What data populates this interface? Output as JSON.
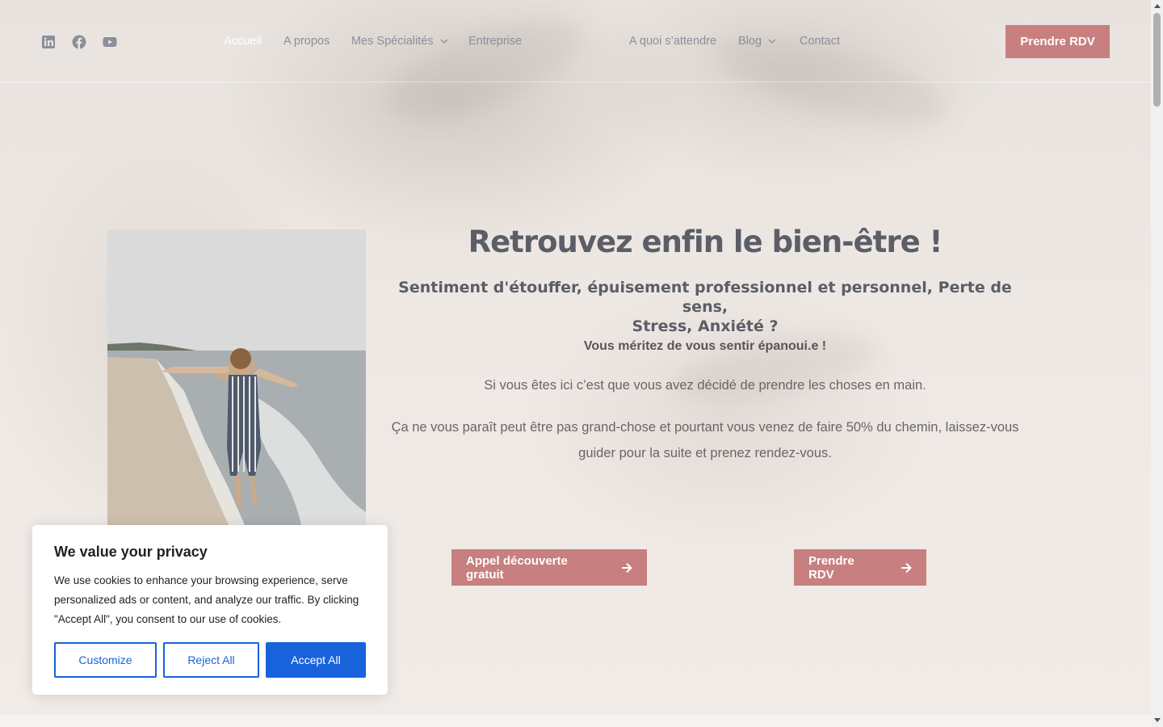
{
  "nav": {
    "items": [
      {
        "label": "Accueil",
        "active": true
      },
      {
        "label": "A propos"
      },
      {
        "label": "Mes Spécialités",
        "dropdown": true
      },
      {
        "label": "Entreprise"
      },
      {
        "label": "A quoi s’attendre"
      },
      {
        "label": "Blog",
        "dropdown": true
      },
      {
        "label": "Contact"
      }
    ],
    "cta_label": "Prendre RDV",
    "social_icons": [
      "linkedin-icon",
      "facebook-icon",
      "youtube-icon"
    ]
  },
  "hero": {
    "title": "Retrouvez enfin le bien-être !",
    "subtitle_line1": "Sentiment d'étouffer, épuisement professionnel et personnel, Perte de sens,",
    "subtitle_line2": "Stress, Anxiété ?",
    "strong_text": "Vous méritez de vous sentir épanoui.e !",
    "paragraph1": "Si vous êtes ici c’est que vous avez décidé de prendre les choses en main.",
    "paragraph2_line1": "Ça ne vous paraît peut être pas grand-chose et pourtant vous venez de faire 50% du chemin, laissez-vous",
    "paragraph2_line2": "guider pour la suite et prenez rendez-vous.",
    "cta_primary": "Appel découverte gratuit",
    "cta_secondary": "Prendre RDV"
  },
  "cookie": {
    "title": "We value your privacy",
    "text": "We use cookies to enhance your browsing experience, serve personalized ads or content, and analyze our traffic. By clicking \"Accept All\", you consent to our use of cookies.",
    "customize": "Customize",
    "reject": "Reject All",
    "accept": "Accept All"
  },
  "colors": {
    "accent": "#c77f7f",
    "cookie_primary": "#1863dc",
    "nav_text": "#8b8f9a",
    "heading": "#5b5e66"
  }
}
